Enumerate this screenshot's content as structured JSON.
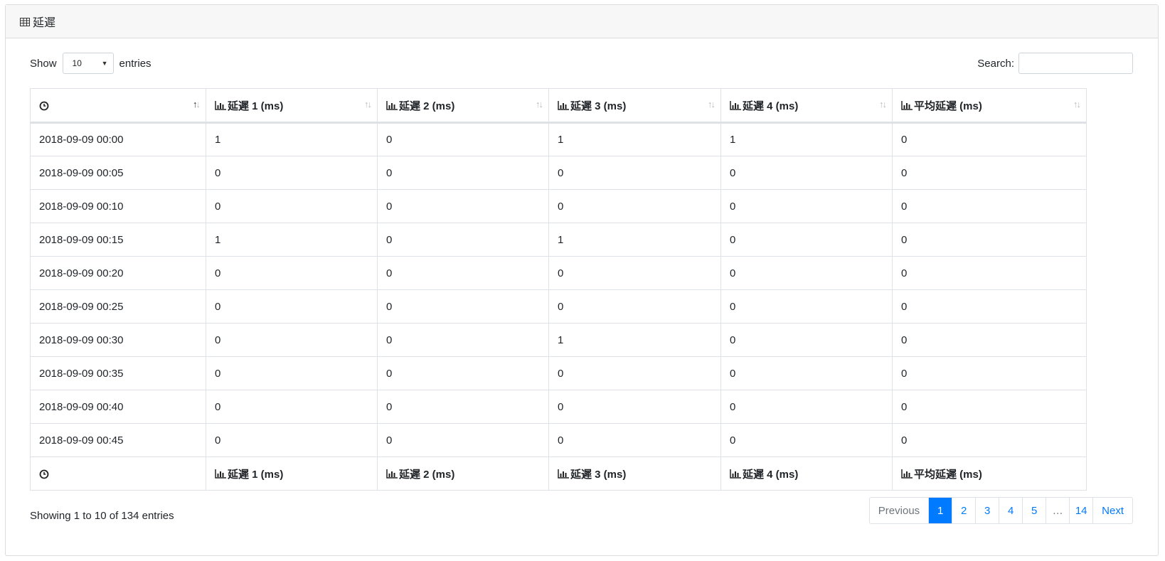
{
  "header": {
    "icon": "table-icon",
    "title": "延遲"
  },
  "controls": {
    "show_label": "Show",
    "length_value": "10",
    "entries_label": "entries",
    "search_label": "Search:",
    "search_value": ""
  },
  "table": {
    "columns": [
      {
        "icon": "clock-icon",
        "label": ""
      },
      {
        "icon": "bar-chart-icon",
        "label": "延遲 1 (ms)"
      },
      {
        "icon": "bar-chart-icon",
        "label": "延遲 2 (ms)"
      },
      {
        "icon": "bar-chart-icon",
        "label": "延遲 3 (ms)"
      },
      {
        "icon": "bar-chart-icon",
        "label": "延遲 4 (ms)"
      },
      {
        "icon": "bar-chart-icon",
        "label": "平均延遲 (ms)"
      }
    ],
    "rows": [
      [
        "2018-09-09 00:00",
        "1",
        "0",
        "1",
        "1",
        "0"
      ],
      [
        "2018-09-09 00:05",
        "0",
        "0",
        "0",
        "0",
        "0"
      ],
      [
        "2018-09-09 00:10",
        "0",
        "0",
        "0",
        "0",
        "0"
      ],
      [
        "2018-09-09 00:15",
        "1",
        "0",
        "1",
        "0",
        "0"
      ],
      [
        "2018-09-09 00:20",
        "0",
        "0",
        "0",
        "0",
        "0"
      ],
      [
        "2018-09-09 00:25",
        "0",
        "0",
        "0",
        "0",
        "0"
      ],
      [
        "2018-09-09 00:30",
        "0",
        "0",
        "1",
        "0",
        "0"
      ],
      [
        "2018-09-09 00:35",
        "0",
        "0",
        "0",
        "0",
        "0"
      ],
      [
        "2018-09-09 00:40",
        "0",
        "0",
        "0",
        "0",
        "0"
      ],
      [
        "2018-09-09 00:45",
        "0",
        "0",
        "0",
        "0",
        "0"
      ]
    ]
  },
  "footer": {
    "info": "Showing 1 to 10 of 134 entries",
    "pagination": {
      "previous": "Previous",
      "pages": [
        "1",
        "2",
        "3",
        "4",
        "5",
        "…",
        "14"
      ],
      "active": "1",
      "next": "Next"
    }
  },
  "colors": {
    "accent": "#007bff",
    "border": "#dee2e6",
    "header_bg": "#f7f7f7"
  }
}
